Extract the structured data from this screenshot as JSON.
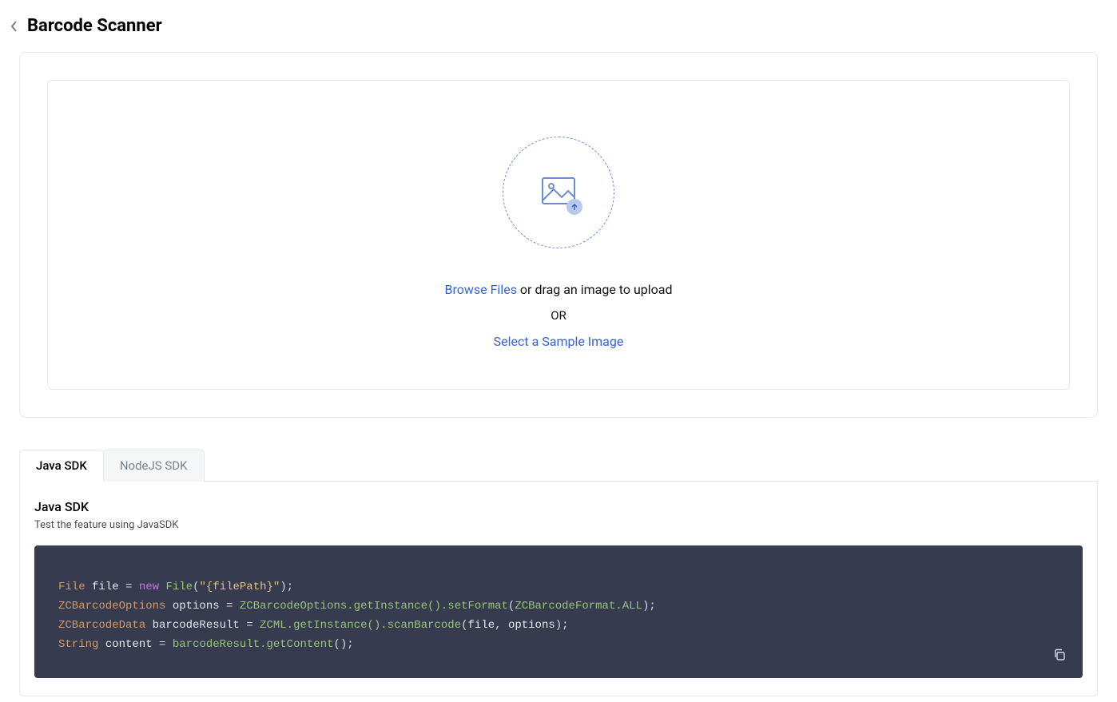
{
  "page": {
    "title": "Barcode Scanner"
  },
  "upload": {
    "browse_link": "Browse Files",
    "drag_text": " or drag an image to upload",
    "or": "OR",
    "sample_link": "Select a Sample Image"
  },
  "tabs": [
    {
      "label": "Java SDK",
      "active": true
    },
    {
      "label": "NodeJS SDK",
      "active": false
    }
  ],
  "sdk": {
    "title": "Java SDK",
    "description": "Test the feature using JavaSDK",
    "code": {
      "line1": {
        "type": "File",
        "var": "file",
        "eq": " = ",
        "kw": "new",
        "cls": " File",
        "open": "(",
        "str": "\"{filePath}\"",
        "close": ");"
      },
      "line2": {
        "type": "ZCBarcodeOptions",
        "var": " options",
        "eq": " = ",
        "call": "ZCBarcodeOptions.getInstance().setFormat",
        "open": "(",
        "arg": "ZCBarcodeFormat.ALL",
        "close": ");"
      },
      "line3": {
        "type": "ZCBarcodeData",
        "var": " barcodeResult",
        "eq": " = ",
        "call": "ZCML.getInstance().scanBarcode",
        "open": "(",
        "arg1": "file",
        "comma": ", ",
        "arg2": "options",
        "close": ");"
      },
      "line4": {
        "type": "String",
        "var": " content",
        "eq": " = ",
        "call": "barcodeResult.getContent",
        "open": "(",
        "close": ");"
      }
    }
  }
}
